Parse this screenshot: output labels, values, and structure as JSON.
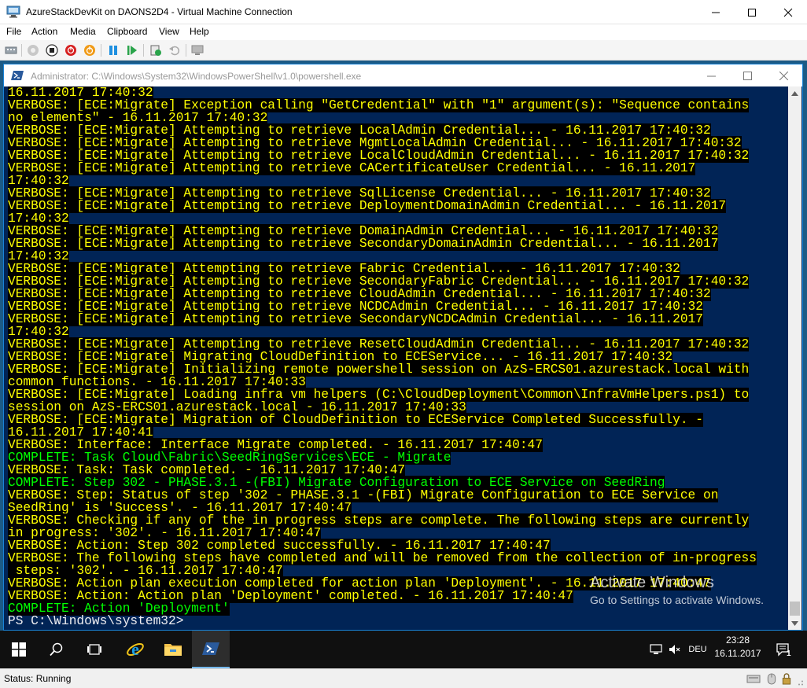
{
  "window": {
    "title": "AzureStackDevKit on DAONS2D4 - Virtual Machine Connection"
  },
  "menu": [
    "File",
    "Action",
    "Media",
    "Clipboard",
    "View",
    "Help"
  ],
  "powershell": {
    "title": "Administrator: C:\\Windows\\System32\\WindowsPowerShell\\v1.0\\powershell.exe",
    "lines": [
      {
        "t": "16.11.2017 17:40:32",
        "c": "yellow"
      },
      {
        "t": "VERBOSE: [ECE:Migrate] Exception calling \"GetCredential\" with \"1\" argument(s): \"Sequence contains",
        "c": "yellow"
      },
      {
        "t": "no elements\" - 16.11.2017 17:40:32",
        "c": "yellow"
      },
      {
        "t": "VERBOSE: [ECE:Migrate] Attempting to retrieve LocalAdmin Credential... - 16.11.2017 17:40:32",
        "c": "yellow"
      },
      {
        "t": "VERBOSE: [ECE:Migrate] Attempting to retrieve MgmtLocalAdmin Credential... - 16.11.2017 17:40:32",
        "c": "yellow"
      },
      {
        "t": "VERBOSE: [ECE:Migrate] Attempting to retrieve LocalCloudAdmin Credential... - 16.11.2017 17:40:32",
        "c": "yellow"
      },
      {
        "t": "VERBOSE: [ECE:Migrate] Attempting to retrieve CACertificateUser Credential... - 16.11.2017",
        "c": "yellow"
      },
      {
        "t": "17:40:32",
        "c": "yellow"
      },
      {
        "t": "VERBOSE: [ECE:Migrate] Attempting to retrieve SqlLicense Credential... - 16.11.2017 17:40:32",
        "c": "yellow"
      },
      {
        "t": "VERBOSE: [ECE:Migrate] Attempting to retrieve DeploymentDomainAdmin Credential... - 16.11.2017",
        "c": "yellow"
      },
      {
        "t": "17:40:32",
        "c": "yellow"
      },
      {
        "t": "VERBOSE: [ECE:Migrate] Attempting to retrieve DomainAdmin Credential... - 16.11.2017 17:40:32",
        "c": "yellow"
      },
      {
        "t": "VERBOSE: [ECE:Migrate] Attempting to retrieve SecondaryDomainAdmin Credential... - 16.11.2017",
        "c": "yellow"
      },
      {
        "t": "17:40:32",
        "c": "yellow"
      },
      {
        "t": "VERBOSE: [ECE:Migrate] Attempting to retrieve Fabric Credential... - 16.11.2017 17:40:32",
        "c": "yellow"
      },
      {
        "t": "VERBOSE: [ECE:Migrate] Attempting to retrieve SecondaryFabric Credential... - 16.11.2017 17:40:32",
        "c": "yellow"
      },
      {
        "t": "VERBOSE: [ECE:Migrate] Attempting to retrieve CloudAdmin Credential... - 16.11.2017 17:40:32",
        "c": "yellow"
      },
      {
        "t": "VERBOSE: [ECE:Migrate] Attempting to retrieve NCDCAdmin Credential... - 16.11.2017 17:40:32",
        "c": "yellow"
      },
      {
        "t": "VERBOSE: [ECE:Migrate] Attempting to retrieve SecondaryNCDCAdmin Credential... - 16.11.2017",
        "c": "yellow"
      },
      {
        "t": "17:40:32",
        "c": "yellow"
      },
      {
        "t": "VERBOSE: [ECE:Migrate] Attempting to retrieve ResetCloudAdmin Credential... - 16.11.2017 17:40:32",
        "c": "yellow"
      },
      {
        "t": "VERBOSE: [ECE:Migrate] Migrating CloudDefinition to ECEService... - 16.11.2017 17:40:32",
        "c": "yellow"
      },
      {
        "t": "VERBOSE: [ECE:Migrate] Initializing remote powershell session on AzS-ERCS01.azurestack.local with",
        "c": "yellow"
      },
      {
        "t": "common functions. - 16.11.2017 17:40:33",
        "c": "yellow"
      },
      {
        "t": "VERBOSE: [ECE:Migrate] Loading infra vm helpers (C:\\CloudDeployment\\Common\\InfraVmHelpers.ps1) to",
        "c": "yellow"
      },
      {
        "t": "session on AzS-ERCS01.azurestack.local - 16.11.2017 17:40:33",
        "c": "yellow"
      },
      {
        "t": "VERBOSE: [ECE:Migrate] Migration of CloudDefinition to ECEService Completed Successfully. -",
        "c": "yellow"
      },
      {
        "t": "16.11.2017 17:40:41",
        "c": "yellow"
      },
      {
        "t": "VERBOSE: Interface: Interface Migrate completed. - 16.11.2017 17:40:47",
        "c": "yellow"
      },
      {
        "t": "COMPLETE: Task Cloud\\Fabric\\SeedRingServices\\ECE - Migrate",
        "c": "green"
      },
      {
        "t": "VERBOSE: Task: Task completed. - 16.11.2017 17:40:47",
        "c": "yellow"
      },
      {
        "t": "COMPLETE: Step 302 - PHASE.3.1 -(FBI) Migrate Configuration to ECE Service on SeedRing",
        "c": "green"
      },
      {
        "t": "VERBOSE: Step: Status of step '302 - PHASE.3.1 -(FBI) Migrate Configuration to ECE Service on",
        "c": "yellow"
      },
      {
        "t": "SeedRing' is 'Success'. - 16.11.2017 17:40:47",
        "c": "yellow"
      },
      {
        "t": "VERBOSE: Checking if any of the in progress steps are complete. The following steps are currently",
        "c": "yellow"
      },
      {
        "t": "in progress: '302'. - 16.11.2017 17:40:47",
        "c": "yellow"
      },
      {
        "t": "VERBOSE: Action: Step 302 completed successfully. - 16.11.2017 17:40:47",
        "c": "yellow"
      },
      {
        "t": "VERBOSE: The following steps have completed and will be removed from the collection of in-progress",
        "c": "yellow"
      },
      {
        "t": " steps: '302'. - 16.11.2017 17:40:47",
        "c": "yellow"
      },
      {
        "t": "VERBOSE: Action plan execution completed for action plan 'Deployment'. - 16.11.2017 17:40:47",
        "c": "yellow"
      },
      {
        "t": "VERBOSE: Action: Action plan 'Deployment' completed. - 16.11.2017 17:40:47",
        "c": "yellow"
      },
      {
        "t": "COMPLETE: Action 'Deployment'",
        "c": "green"
      },
      {
        "t": "PS C:\\Windows\\system32>",
        "c": "white"
      }
    ],
    "colors": {
      "background": "#012456",
      "yellow": "#ffff00",
      "green": "#00ff00",
      "prompt": "#eeedf0"
    }
  },
  "watermark": {
    "title": "Activate Windows",
    "subtitle": "Go to Settings to activate Windows."
  },
  "taskbar": {
    "language": "DEU",
    "time": "23:28",
    "date": "16.11.2017",
    "notification_count": "1"
  },
  "status": {
    "text": "Status: Running"
  }
}
